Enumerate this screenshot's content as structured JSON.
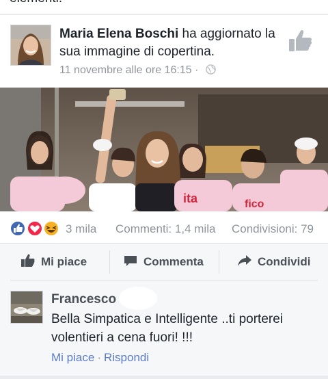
{
  "top_fragment": "elementi.",
  "post": {
    "author": "Maria Elena Boschi",
    "action": "ha aggiornato la sua immagine di copertina.",
    "timestamp": "11 novembre alle ore 16:15",
    "separator": "·",
    "privacy_icon": "globe-icon",
    "corner_icon": "thumbs-up-icon"
  },
  "stats": {
    "reaction_icons": [
      "like-reaction-icon",
      "love-reaction-icon",
      "haha-reaction-icon"
    ],
    "reactions": "3 mila",
    "comments": "Commenti: 1,4 mila",
    "shares": "Condivisioni: 79"
  },
  "actions": {
    "like": "Mi piace",
    "comment": "Commenta",
    "share": "Condividi"
  },
  "comment": {
    "author": "Francesco",
    "text": "Bella Simpatica e Intelligente ..ti porterei volentieri a cena fuori! !!!",
    "like": "Mi piace",
    "separator": "·",
    "reply": "Rispondi"
  },
  "colors": {
    "link": "#5b7bc6",
    "meta": "#90949c",
    "button_text": "#4b4f56",
    "like_blue": "#4267b2",
    "love_red": "#f0284a",
    "haha_yellow": "#f7b125"
  }
}
